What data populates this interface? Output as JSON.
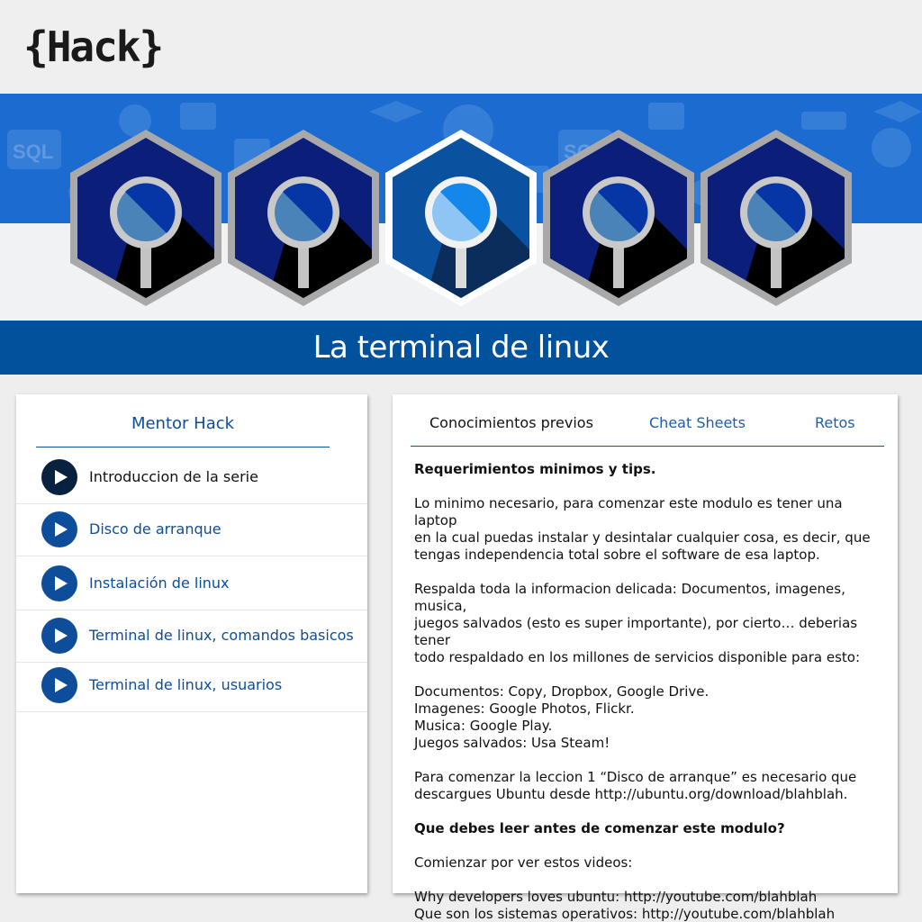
{
  "header": {
    "logo_text": "{Hack}"
  },
  "course": {
    "title": "La terminal de linux"
  },
  "sidebar": {
    "title": "Mentor Hack",
    "items": [
      {
        "label": "Introduccion de la serie",
        "active": true
      },
      {
        "label": "Disco de arranque",
        "active": false
      },
      {
        "label": "Instalación de linux",
        "active": false
      },
      {
        "label": "Terminal de linux, comandos basicos",
        "active": false
      },
      {
        "label": "Terminal de linux, usuarios",
        "active": false
      }
    ]
  },
  "tabs": [
    {
      "label": "Conocimientos previos",
      "active": true
    },
    {
      "label": "Cheat Sheets",
      "active": false
    },
    {
      "label": "Retos",
      "active": false
    }
  ],
  "content": {
    "heading1": "Requerimientos minimos y tips.",
    "p1_l1": "Lo minimo necesario, para comenzar este modulo es tener una laptop",
    "p1_l2": "en la cual puedas instalar y desintalar cualquier cosa, es decir, que",
    "p1_l3": "tengas independencia total sobre el software de esa laptop.",
    "p2_l1": "Respalda toda la informacion delicada: Documentos, imagenes, musica,",
    "p2_l2": "juegos salvados (esto es super importante), por cierto… deberias tener",
    "p2_l3": "todo respaldado en los millones de servicios disponible para esto:",
    "list1": "Documentos: Copy, Dropbox, Google Drive.",
    "list2": "Imagenes: Google Photos, Flickr.",
    "list3": "Musica: Google Play.",
    "list4": "Juegos salvados: Usa Steam!",
    "p3_l1": "Para comenzar la leccion 1 “Disco de arranque” es necesario que",
    "p3_l2": "descargues Ubuntu desde http://ubuntu.org/download/blahblah.",
    "heading2": "Que debes leer antes de comenzar este modulo?",
    "p4": "Comienzar por ver estos videos:",
    "video1": "Why developers loves ubuntu: http://youtube.com/blahblah",
    "video2": "Que son los sistemas operativos: http://youtube.com/blahblah"
  },
  "colors": {
    "brand_blue": "#02519c",
    "banner_blue": "#1c6bd0",
    "link_blue": "#0d4d9a",
    "active_dark": "#07213f"
  }
}
